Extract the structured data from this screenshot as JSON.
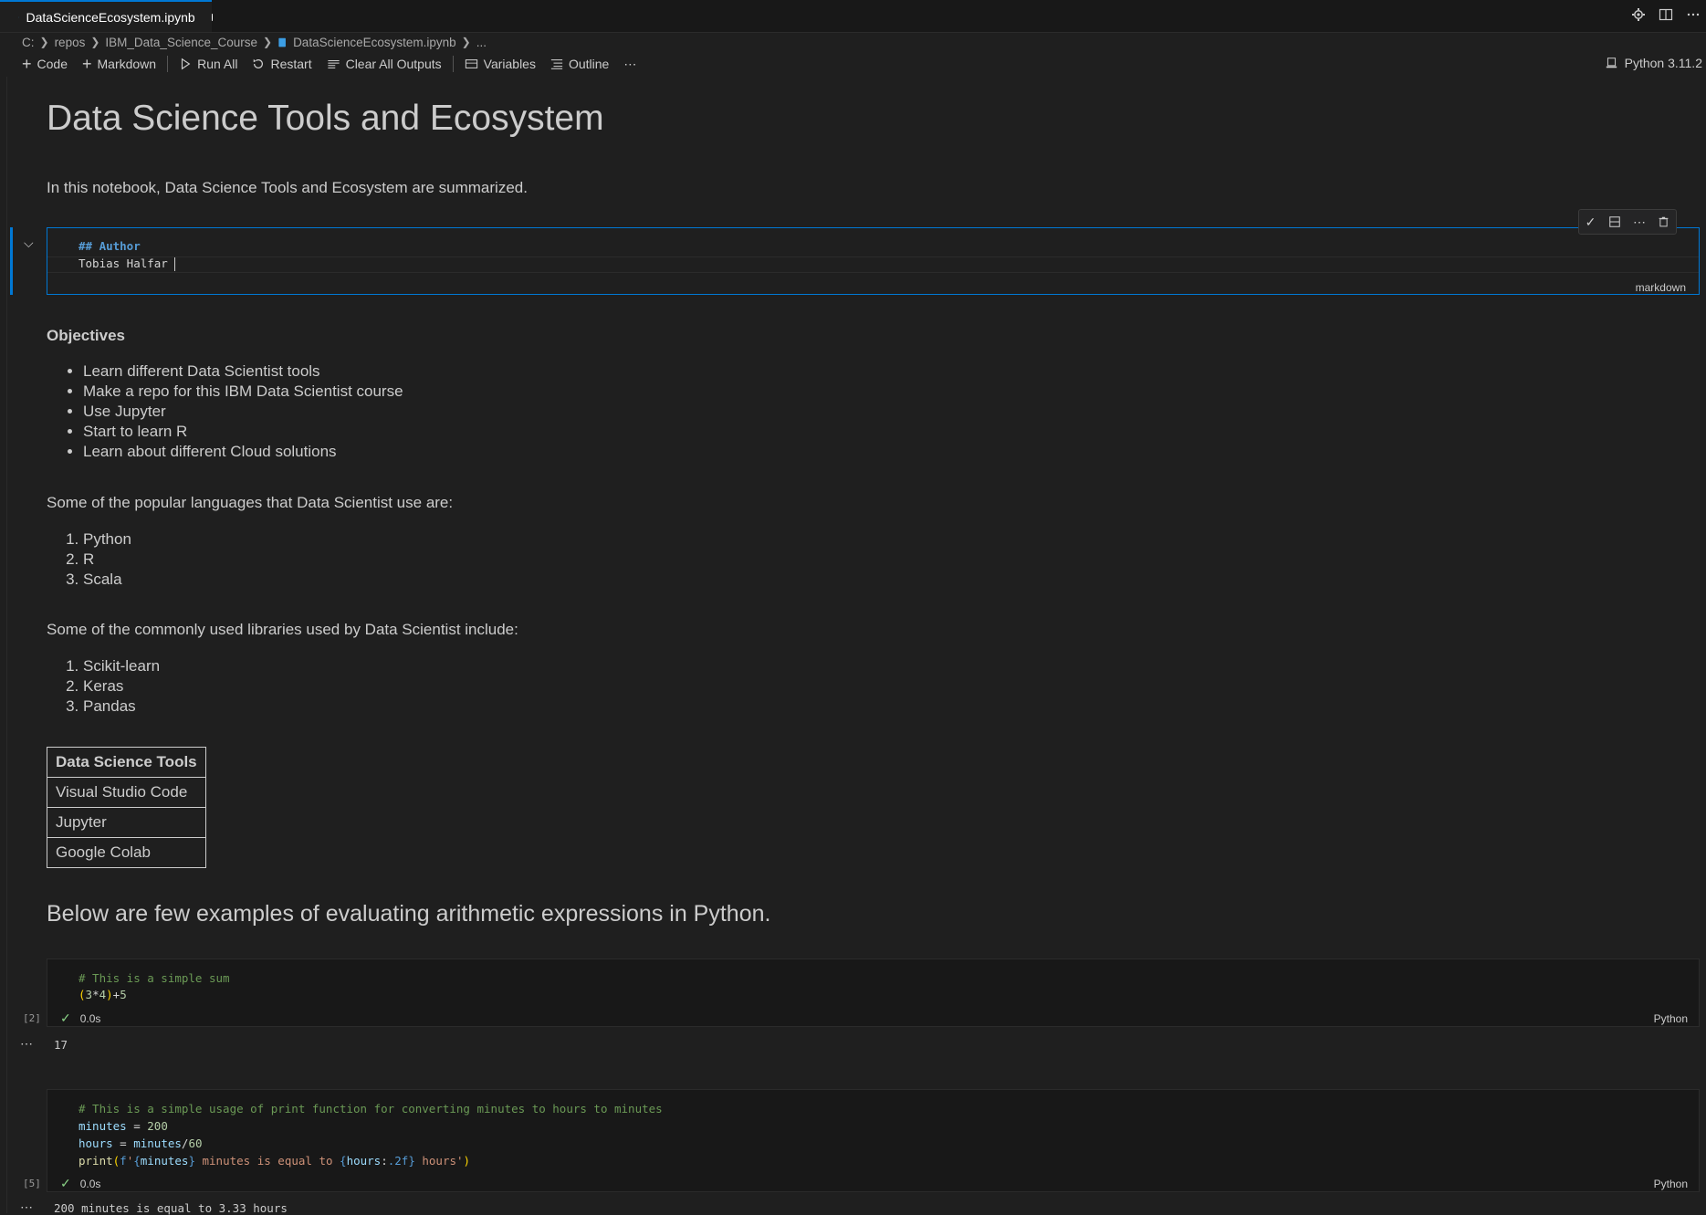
{
  "tab": {
    "filename": "DataScienceEcosystem.ipynb"
  },
  "breadcrumb": [
    "C:",
    "repos",
    "IBM_Data_Science_Course",
    "DataScienceEcosystem.ipynb",
    "..."
  ],
  "toolbar": {
    "code": "Code",
    "markdown": "Markdown",
    "run_all": "Run All",
    "restart": "Restart",
    "clear_outputs": "Clear All Outputs",
    "variables": "Variables",
    "outline": "Outline",
    "more": "⋯",
    "kernel": "Python 3.11.2"
  },
  "notebook": {
    "title": "Data Science Tools and Ecosystem",
    "intro": "In this notebook, Data Science Tools and Ecosystem are summarized.",
    "edit_cell": {
      "line1": "## Author",
      "line2": "Tobias Halfar ",
      "type": "markdown"
    },
    "objectives_heading": "Objectives",
    "objectives": [
      "Learn different Data Scientist tools",
      "Make a repo for this IBM Data Scientist course",
      "Use Jupyter",
      "Start to learn R",
      "Learn about different Cloud solutions"
    ],
    "languages_intro": "Some of the popular languages that Data Scientist use are:",
    "languages": [
      "Python",
      "R",
      "Scala"
    ],
    "libraries_intro": "Some of the commonly used libraries used by Data Scientist include:",
    "libraries": [
      "Scikit-learn",
      "Keras",
      "Pandas"
    ],
    "table": {
      "header": "Data Science Tools",
      "rows": [
        "Visual Studio Code",
        "Jupyter",
        "Google Colab"
      ]
    },
    "arith_heading": "Below are few examples of evaluating arithmetic expressions in Python.",
    "cell1": {
      "exec": "[2]",
      "comment": "# This is a simple sum",
      "time": "0.0s",
      "lang": "Python",
      "output": "17"
    },
    "cell2": {
      "exec": "[5]",
      "comment": "# This is a simple usage of print function for converting minutes to hours to minutes",
      "time": "0.0s",
      "lang": "Python",
      "output": "200 minutes is equal to 3.33 hours"
    }
  }
}
